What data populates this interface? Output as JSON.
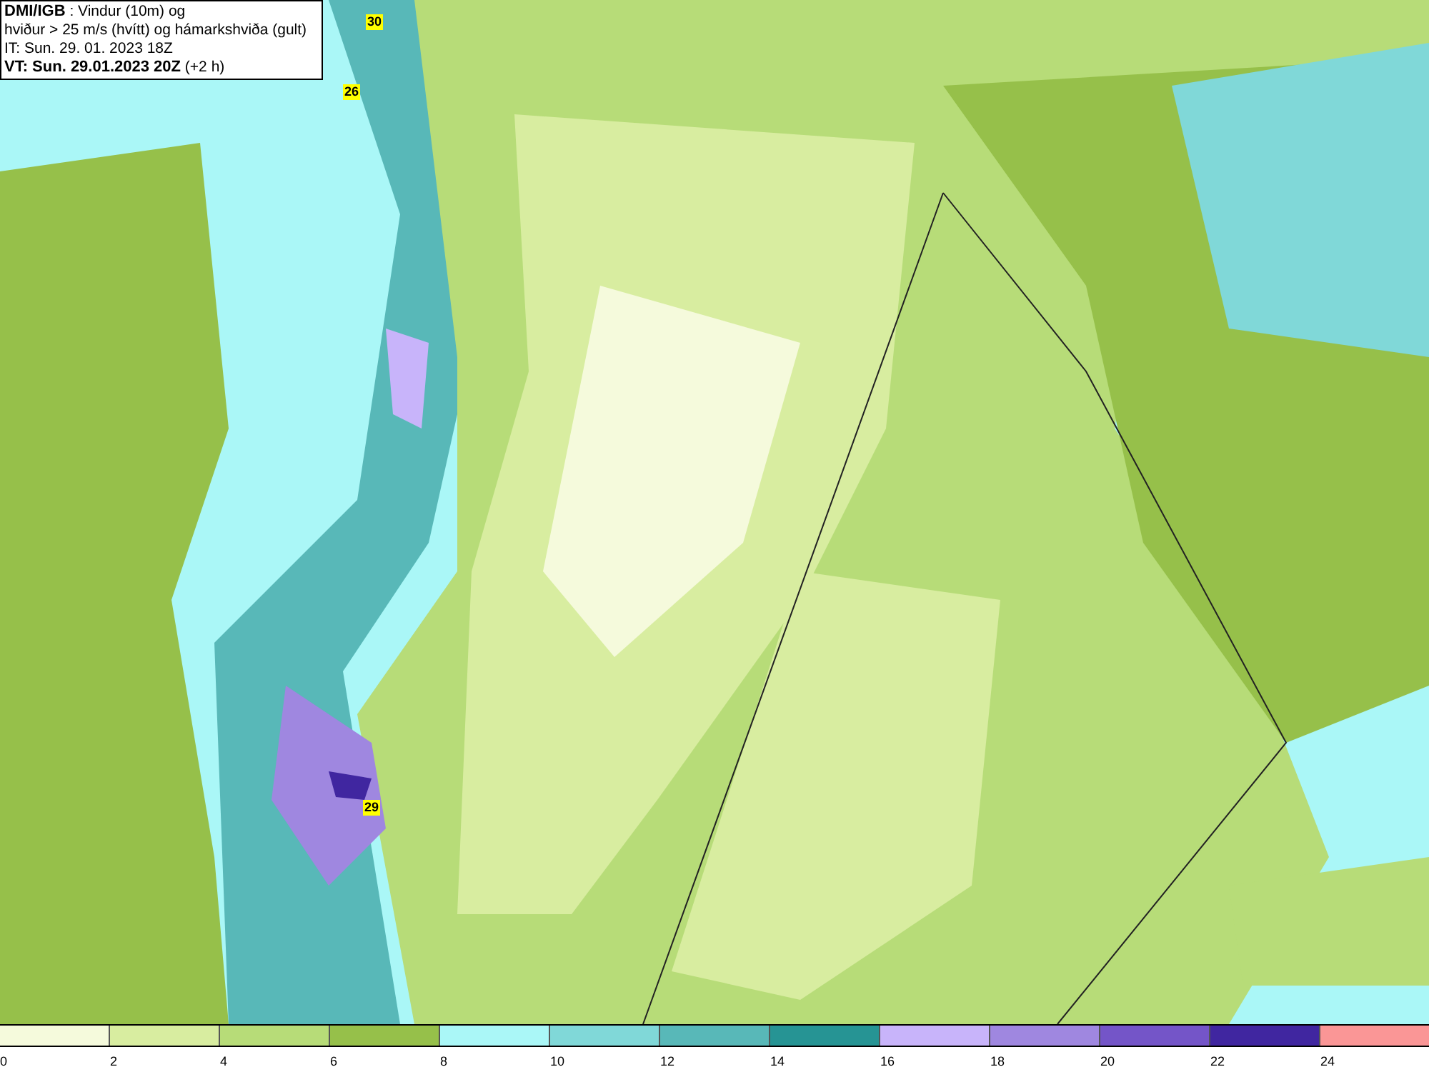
{
  "header": {
    "lines": [
      "**DMI/IGB** : Vindur (10m) og",
      "hviður > 25 m/s (hvítt) og hámarkshviða (gult)",
      "IT: Sun. 29. 01. 2023 18Z",
      "**VT: Sun. 29.01.2023 20Z** (+2 h)"
    ]
  },
  "map": {
    "gust_labels": [
      {
        "text": "30"
      },
      {
        "text": "26"
      },
      {
        "text": "29"
      }
    ]
  },
  "legend": {
    "bins": [
      {
        "label": "0",
        "color": "#f5fadc"
      },
      {
        "label": "2",
        "color": "#d8eda0"
      },
      {
        "label": "4",
        "color": "#b7dc78"
      },
      {
        "label": "6",
        "color": "#96c04a"
      },
      {
        "label": "8",
        "color": "#aaf7f7"
      },
      {
        "label": "10",
        "color": "#80d8d8"
      },
      {
        "label": "12",
        "color": "#58b8b8"
      },
      {
        "label": "14",
        "color": "#269494"
      },
      {
        "label": "16",
        "color": "#c8b4fa"
      },
      {
        "label": "18",
        "color": "#9f87e0"
      },
      {
        "label": "20",
        "color": "#7455c8"
      },
      {
        "label": "22",
        "color": "#4026a0"
      },
      {
        "label": "24",
        "color": "#fa9696"
      }
    ]
  }
}
